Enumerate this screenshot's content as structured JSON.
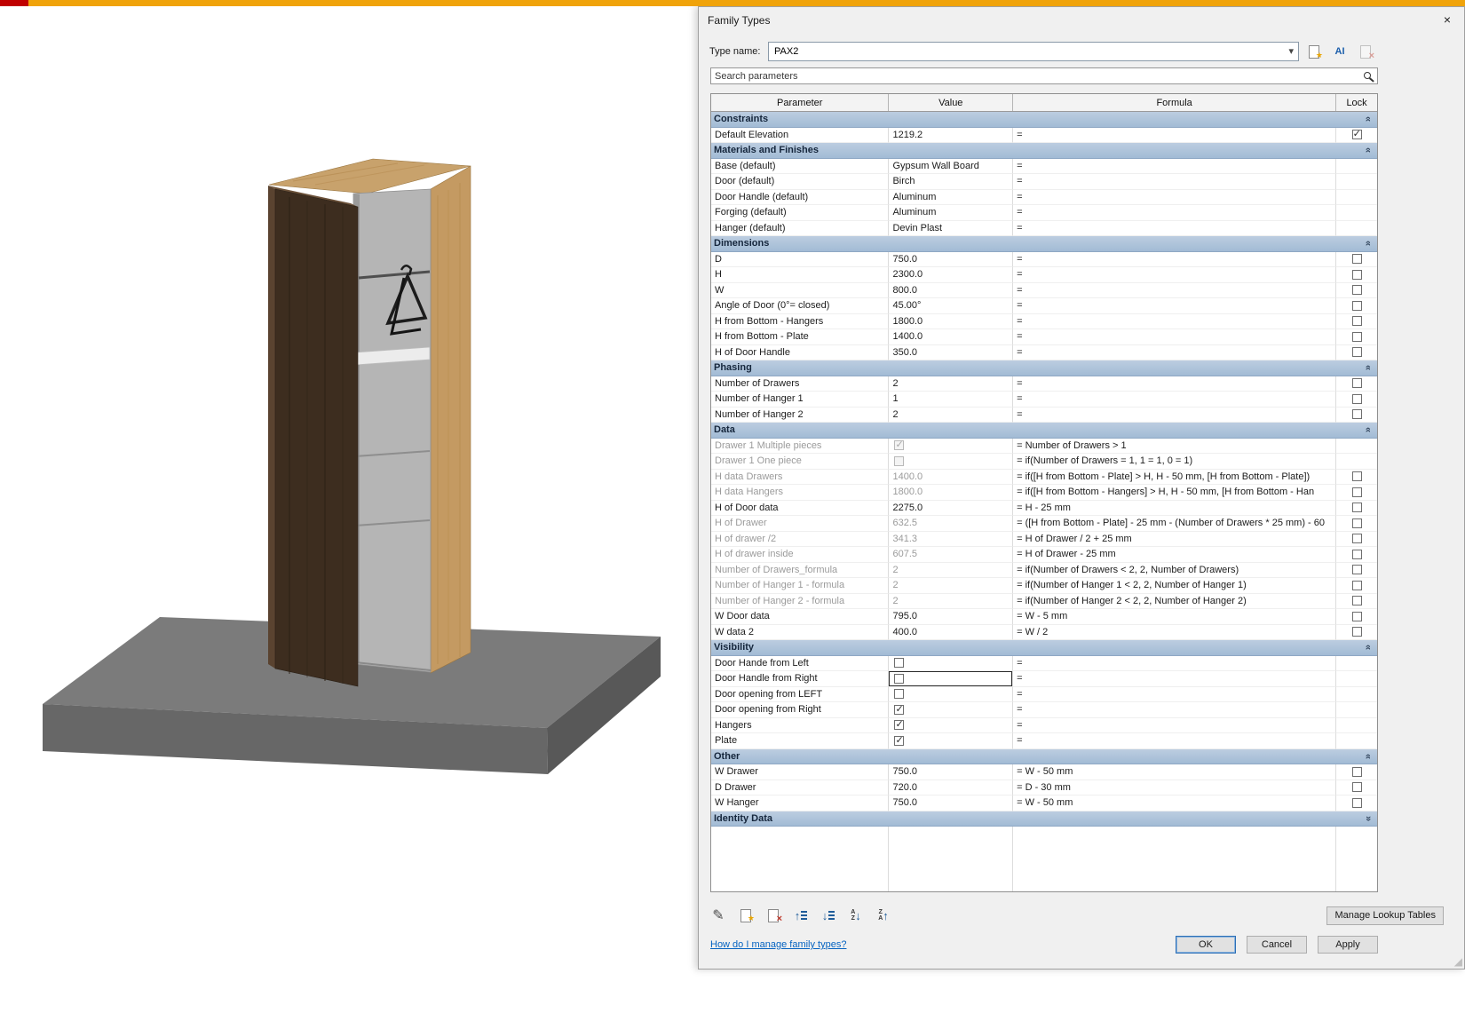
{
  "chrome": {
    "top_bar_color": "#F0A30A",
    "top_left_accent_color": "#C00000"
  },
  "dialog": {
    "title": "Family Types",
    "close_icon": "×",
    "type_name": {
      "label": "Type name:",
      "value": "PAX2"
    },
    "search": {
      "placeholder": "Search parameters"
    },
    "table": {
      "headers": [
        "Parameter",
        "Value",
        "Formula",
        "Lock"
      ],
      "sections": [
        {
          "title": "Constraints",
          "collapsed": false,
          "rows": [
            {
              "param": "Default Elevation",
              "value": "1219.2",
              "formula": "=",
              "lock": "checked"
            }
          ]
        },
        {
          "title": "Materials and Finishes",
          "collapsed": false,
          "rows": [
            {
              "param": "Base (default)",
              "value": "Gypsum Wall Board",
              "formula": "=",
              "lock": "none"
            },
            {
              "param": "Door (default)",
              "value": "Birch",
              "formula": "=",
              "lock": "none"
            },
            {
              "param": "Door Handle (default)",
              "value": "Aluminum",
              "formula": "=",
              "lock": "none"
            },
            {
              "param": "Forging (default)",
              "value": "Aluminum",
              "formula": "=",
              "lock": "none"
            },
            {
              "param": "Hanger (default)",
              "value": "Devin Plast",
              "formula": "=",
              "lock": "none"
            }
          ]
        },
        {
          "title": "Dimensions",
          "collapsed": false,
          "rows": [
            {
              "param": "D",
              "value": "750.0",
              "formula": "=",
              "lock": "unchecked"
            },
            {
              "param": "H",
              "value": "2300.0",
              "formula": "=",
              "lock": "unchecked"
            },
            {
              "param": "W",
              "value": "800.0",
              "formula": "=",
              "lock": "unchecked"
            },
            {
              "param": "Angle of Door (0°= closed)",
              "value": "45.00°",
              "formula": "=",
              "lock": "unchecked"
            },
            {
              "param": "H from Bottom - Hangers",
              "value": "1800.0",
              "formula": "=",
              "lock": "unchecked"
            },
            {
              "param": "H from Bottom - Plate",
              "value": "1400.0",
              "formula": "=",
              "lock": "unchecked"
            },
            {
              "param": "H of Door Handle",
              "value": "350.0",
              "formula": "=",
              "lock": "unchecked"
            }
          ]
        },
        {
          "title": "Phasing",
          "collapsed": false,
          "rows": [
            {
              "param": "Number of Drawers",
              "value": "2",
              "formula": "=",
              "lock": "unchecked"
            },
            {
              "param": "Number of Hanger 1",
              "value": "1",
              "formula": "=",
              "lock": "unchecked"
            },
            {
              "param": "Number of Hanger 2",
              "value": "2",
              "formula": "=",
              "lock": "unchecked"
            }
          ]
        },
        {
          "title": "Data",
          "collapsed": false,
          "rows": [
            {
              "param": "Drawer 1 Multiple pieces",
              "value_kind": "checkbox",
              "checked": true,
              "gray": true,
              "formula": "= Number of Drawers > 1",
              "lock": "none"
            },
            {
              "param": "Drawer 1 One piece",
              "value_kind": "checkbox",
              "checked": false,
              "gray": true,
              "formula": "= if(Number of Drawers = 1, 1 = 1, 0 = 1)",
              "lock": "none"
            },
            {
              "param": "H data Drawers",
              "value": "1400.0",
              "gray": true,
              "formula": "= if([H from Bottom - Plate] > H, H - 50 mm, [H from Bottom - Plate])",
              "lock": "unchecked"
            },
            {
              "param": "H data Hangers",
              "value": "1800.0",
              "gray": true,
              "formula": "= if([H from Bottom - Hangers] > H, H - 50 mm, [H from Bottom - Han",
              "lock": "unchecked"
            },
            {
              "param": "H of Door data",
              "value": "2275.0",
              "formula": "= H - 25 mm",
              "lock": "unchecked"
            },
            {
              "param": "H of Drawer",
              "value": "632.5",
              "gray": true,
              "formula": "= ([H from Bottom - Plate] - 25 mm - (Number of Drawers * 25 mm) - 60",
              "lock": "unchecked"
            },
            {
              "param": "H of drawer /2",
              "value": "341.3",
              "gray": true,
              "formula": "= H of Drawer / 2 + 25 mm",
              "lock": "unchecked"
            },
            {
              "param": "H of drawer inside",
              "value": "607.5",
              "gray": true,
              "formula": "= H of Drawer - 25 mm",
              "lock": "unchecked"
            },
            {
              "param": "Number of Drawers_formula",
              "value": "2",
              "gray": true,
              "formula": "= if(Number of Drawers < 2, 2, Number of Drawers)",
              "lock": "unchecked"
            },
            {
              "param": "Number of Hanger 1 - formula",
              "value": "2",
              "gray": true,
              "formula": "= if(Number of Hanger 1 < 2, 2, Number of Hanger 1)",
              "lock": "unchecked"
            },
            {
              "param": "Number of Hanger 2 - formula",
              "value": "2",
              "gray": true,
              "formula": "= if(Number of Hanger 2 < 2, 2, Number of Hanger 2)",
              "lock": "unchecked"
            },
            {
              "param": "W Door data",
              "value": "795.0",
              "formula": "= W - 5 mm",
              "lock": "unchecked"
            },
            {
              "param": "W data 2",
              "value": "400.0",
              "formula": "= W / 2",
              "lock": "unchecked"
            }
          ]
        },
        {
          "title": "Visibility",
          "collapsed": false,
          "rows": [
            {
              "param": "Door Hande from Left",
              "value_kind": "checkbox",
              "checked": false,
              "formula": "=",
              "lock": "none"
            },
            {
              "param": "Door Handle from Right",
              "value_kind": "checkbox",
              "checked": false,
              "focused": true,
              "formula": "=",
              "lock": "none"
            },
            {
              "param": "Door opening from LEFT",
              "value_kind": "checkbox",
              "checked": false,
              "formula": "=",
              "lock": "none"
            },
            {
              "param": "Door opening from Right",
              "value_kind": "checkbox",
              "checked": true,
              "formula": "=",
              "lock": "none"
            },
            {
              "param": "Hangers",
              "value_kind": "checkbox",
              "checked": true,
              "formula": "=",
              "lock": "none"
            },
            {
              "param": "Plate",
              "value_kind": "checkbox",
              "checked": true,
              "formula": "=",
              "lock": "none"
            }
          ]
        },
        {
          "title": "Other",
          "collapsed": false,
          "rows": [
            {
              "param": "W Drawer",
              "value": "750.0",
              "formula": "= W - 50 mm",
              "lock": "unchecked"
            },
            {
              "param": "D Drawer",
              "value": "720.0",
              "formula": "= D - 30 mm",
              "lock": "unchecked"
            },
            {
              "param": "W Hanger",
              "value": "750.0",
              "formula": "= W - 50 mm",
              "lock": "unchecked"
            }
          ]
        },
        {
          "title": "Identity Data",
          "collapsed": true,
          "rows": []
        }
      ]
    },
    "toolbar": {
      "manage_lookup_tables": "Manage Lookup Tables"
    },
    "footer": {
      "help_link": "How do I manage family types?",
      "ok": "OK",
      "cancel": "Cancel",
      "apply": "Apply"
    }
  }
}
